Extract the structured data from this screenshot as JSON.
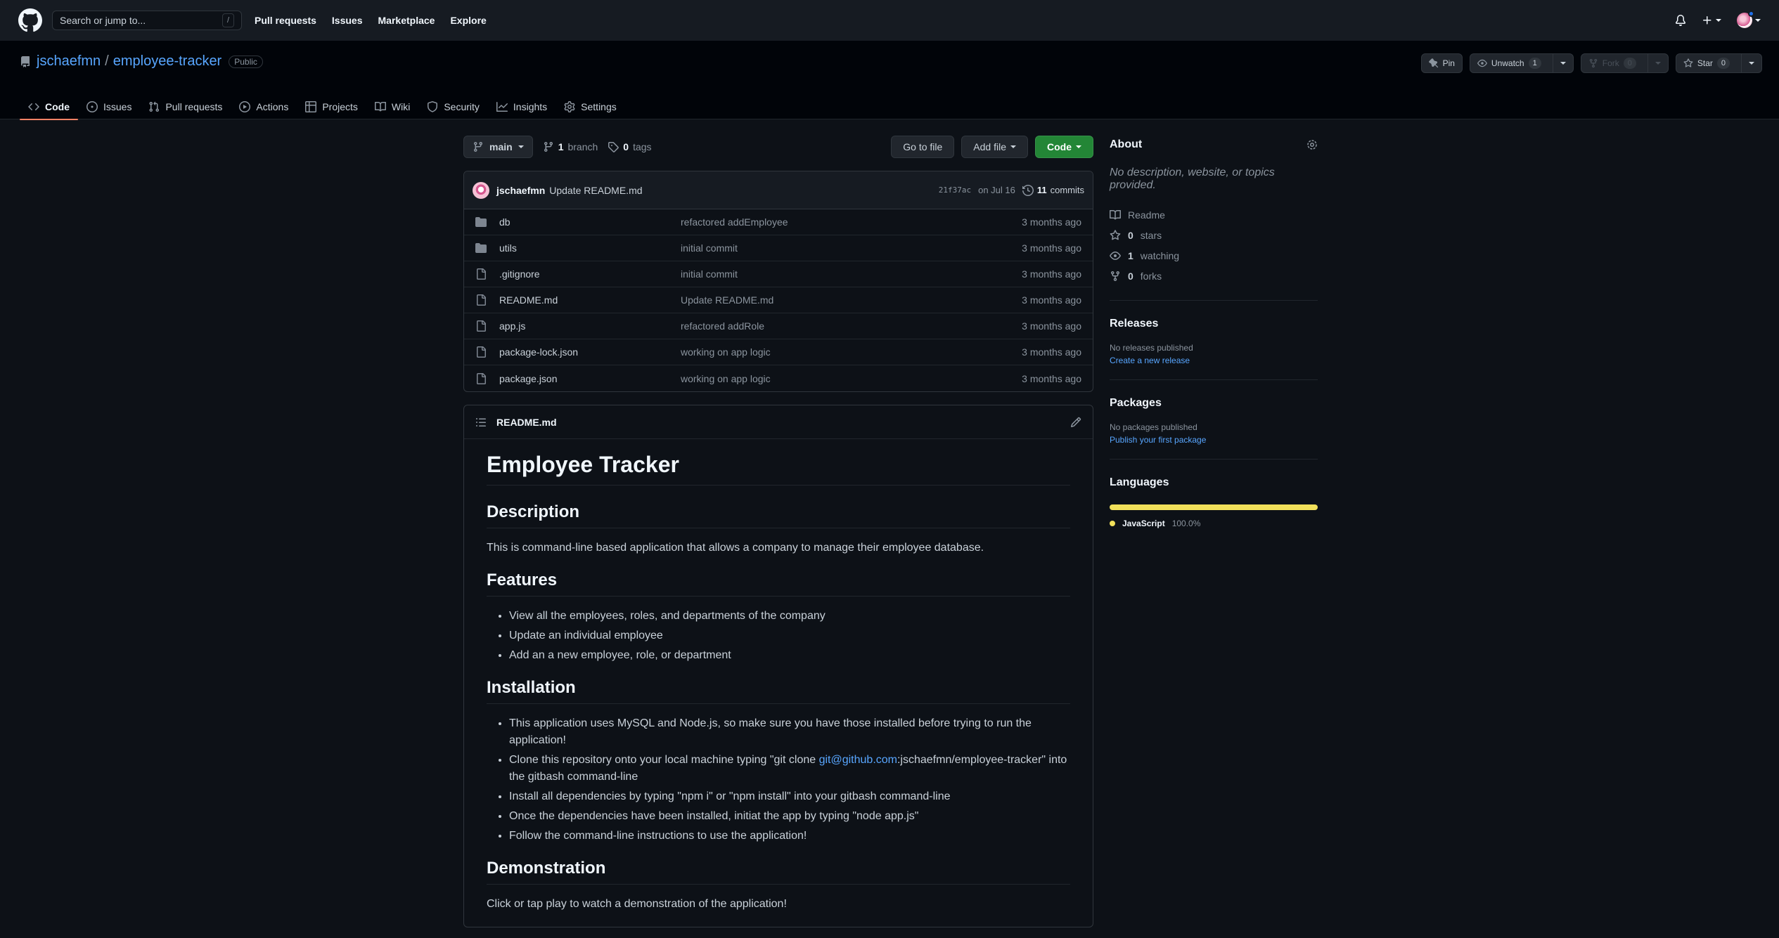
{
  "header": {
    "search_placeholder": "Search or jump to...",
    "search_key": "/",
    "nav": [
      "Pull requests",
      "Issues",
      "Marketplace",
      "Explore"
    ]
  },
  "repo": {
    "owner": "jschaefmn",
    "separator": "/",
    "name": "employee-tracker",
    "visibility": "Public",
    "actions": {
      "pin": "Pin",
      "unwatch": "Unwatch",
      "watch_count": "1",
      "fork": "Fork",
      "fork_count": "0",
      "star": "Star",
      "star_count": "0"
    },
    "tabs": [
      {
        "label": "Code",
        "icon": "code-icon"
      },
      {
        "label": "Issues",
        "icon": "issue-icon"
      },
      {
        "label": "Pull requests",
        "icon": "pull-request-icon"
      },
      {
        "label": "Actions",
        "icon": "play-icon"
      },
      {
        "label": "Projects",
        "icon": "table-icon"
      },
      {
        "label": "Wiki",
        "icon": "book-icon"
      },
      {
        "label": "Security",
        "icon": "shield-icon"
      },
      {
        "label": "Insights",
        "icon": "graph-icon"
      },
      {
        "label": "Settings",
        "icon": "gear-icon"
      }
    ]
  },
  "toolbar": {
    "branch": "main",
    "branch_count": "1",
    "branch_label": "branch",
    "tag_count": "0",
    "tag_label": "tags",
    "go_to_file": "Go to file",
    "add_file": "Add file",
    "code": "Code"
  },
  "latest_commit": {
    "author": "jschaefmn",
    "message": "Update README.md",
    "sha": "21f37ac",
    "date": "on Jul 16",
    "commit_count": "11",
    "commit_label": "commits"
  },
  "files": [
    {
      "type": "folder",
      "name": "db",
      "commit": "refactored addEmployee",
      "age": "3 months ago"
    },
    {
      "type": "folder",
      "name": "utils",
      "commit": "initial commit",
      "age": "3 months ago"
    },
    {
      "type": "file",
      "name": ".gitignore",
      "commit": "initial commit",
      "age": "3 months ago"
    },
    {
      "type": "file",
      "name": "README.md",
      "commit": "Update README.md",
      "age": "3 months ago"
    },
    {
      "type": "file",
      "name": "app.js",
      "commit": "refactored addRole",
      "age": "3 months ago"
    },
    {
      "type": "file",
      "name": "package-lock.json",
      "commit": "working on app logic",
      "age": "3 months ago"
    },
    {
      "type": "file",
      "name": "package.json",
      "commit": "working on app logic",
      "age": "3 months ago"
    }
  ],
  "readme": {
    "filename": "README.md",
    "title": "Employee Tracker",
    "description_h": "Description",
    "description": "This is command-line based application that allows a company to manage their employee database.",
    "features_h": "Features",
    "features": [
      "View all the employees, roles, and departments of the company",
      "Update an individual employee",
      "Add an a new employee, role, or department"
    ],
    "installation_h": "Installation",
    "install_1": "This application uses MySQL and Node.js, so make sure you have those installed before trying to run the application!",
    "install_2_pre": "Clone this repository onto your local machine typing \"git clone ",
    "install_2_link": "git@github.com",
    "install_2_post": ":jschaefmn/employee-tracker\" into the gitbash command-line",
    "install_3": "Install all dependencies by typing \"npm i\" or \"npm install\" into your gitbash command-line",
    "install_4": "Once the dependencies have been installed, initiat the app by typing \"node app.js\"",
    "install_5": "Follow the command-line instructions to use the application!",
    "demo_h": "Demonstration",
    "demo": "Click or tap play to watch a demonstration of the application!"
  },
  "sidebar": {
    "about": "About",
    "description": "No description, website, or topics provided.",
    "readme": "Readme",
    "stars_count": "0",
    "stars": "stars",
    "watching_count": "1",
    "watching": "watching",
    "forks_count": "0",
    "forks": "forks",
    "releases": "Releases",
    "no_releases": "No releases published",
    "create_release": "Create a new release",
    "packages": "Packages",
    "no_packages": "No packages published",
    "publish_package": "Publish your first package",
    "languages": "Languages",
    "lang_name": "JavaScript",
    "lang_pct": "100.0%",
    "lang_color": "#f1e05a"
  }
}
